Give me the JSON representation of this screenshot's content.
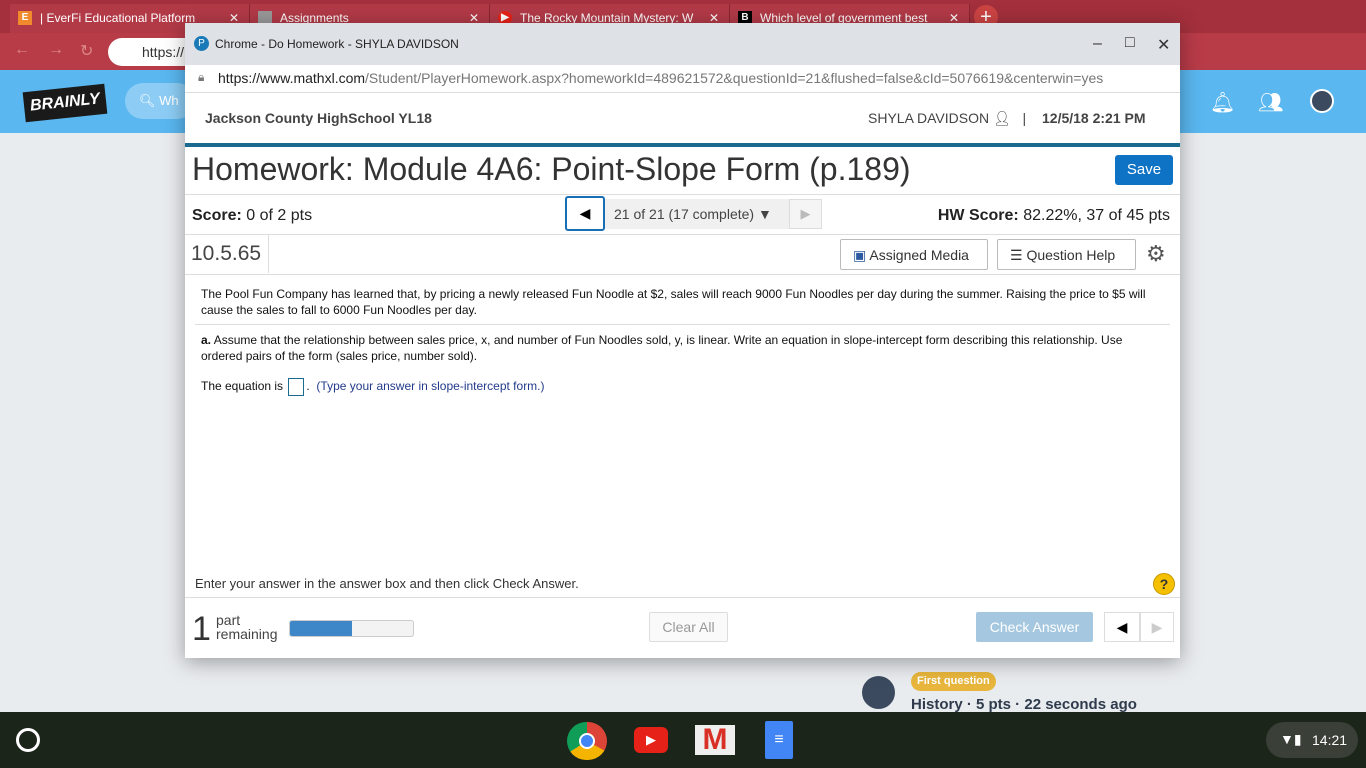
{
  "browser": {
    "tabs": [
      {
        "label": "| EverFi Educational Platform",
        "icon": "everfi-icon"
      },
      {
        "label": "Assignments",
        "icon": "doc-icon"
      },
      {
        "label": "The Rocky Mountain Mystery: W",
        "icon": "youtube-icon"
      },
      {
        "label": "Which level of government best",
        "icon": "brainly-icon"
      }
    ],
    "omnibox": "https://"
  },
  "brainly": {
    "logo": "BRAINLY",
    "search_placeholder": "Wh",
    "feed": {
      "badge": "First question",
      "meta": "History · 5 pts · 22 seconds ago"
    }
  },
  "popup": {
    "title": "Chrome - Do Homework - SHYLA DAVIDSON",
    "url_host": "https://www.mathxl.com",
    "url_path": "/Student/PlayerHomework.aspx?homeworkId=489621572&questionId=21&flushed=false&cId=5076619&centerwin=yes"
  },
  "header": {
    "school": "Jackson County HighSchool YL18",
    "user": "SHYLA DAVIDSON",
    "datetime": "12/5/18 2:21 PM"
  },
  "homework": {
    "title": "Homework: Module 4A6: Point-Slope Form (p.189)",
    "save": "Save",
    "score_label": "Score:",
    "score": "0 of 2 pts",
    "question_select": "21 of 21 (17 complete)",
    "hw_score_label": "HW Score:",
    "hw_score": "82.22%, 37 of 45 pts",
    "question_number": "10.5.65",
    "assigned_media": "Assigned Media",
    "question_help": "Question Help"
  },
  "question": {
    "intro": "The Pool Fun Company has learned that, by pricing a newly released Fun Noodle at $2, sales will reach 9000 Fun Noodles per day during the summer.  Raising the price to $5 will cause the sales to fall to 6000 Fun Noodles per day.",
    "part_label": "a.",
    "part_text": "Assume that the relationship between sales price, x, and number of Fun Noodles sold,  y, is linear.  Write an equation in slope-intercept form describing this relationship.  Use ordered pairs of the form (sales price, number sold).",
    "answer_prefix": "The equation is",
    "answer_suffix": ".",
    "hint": "(Type your answer in slope-intercept form.)"
  },
  "footer": {
    "instruction": "Enter your answer in the answer box and then click Check Answer.",
    "parts_remaining": "1",
    "part_label": "part",
    "remaining_label": "remaining",
    "progress_percent": 50,
    "clear_all": "Clear All",
    "check_answer": "Check Answer"
  },
  "taskbar": {
    "time": "14:21"
  }
}
